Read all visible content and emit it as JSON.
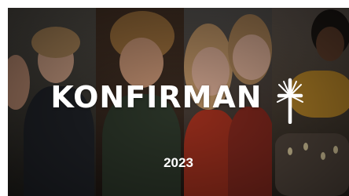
{
  "title": "KONFIRMAN",
  "year": "2023",
  "colors": {
    "text": "#ffffff",
    "background": "#1a1713"
  }
}
